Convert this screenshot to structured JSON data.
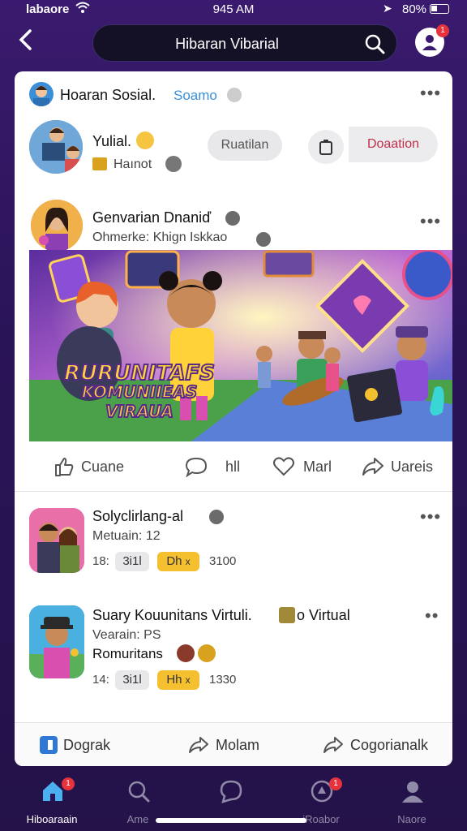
{
  "status_bar": {
    "carrier": "labaore",
    "time": "945 AM",
    "battery": "80%"
  },
  "header": {
    "title": "Hibaran Vibarial",
    "notification_count": "1"
  },
  "community": {
    "name": "Hoaran Sosial.",
    "tag": "Soamo"
  },
  "user": {
    "name": "Yulial.",
    "sub": "Haınot",
    "join_label": "Ruatilan",
    "donate_label": "Doaation"
  },
  "post": {
    "author": "Genvarian Dnaniď",
    "meta": "Ohmerke: Khign Iskkao",
    "banner_line1": "RURUNITAFS",
    "banner_line2": "KOMUNIIEAS",
    "banner_line3": "VIRAUA",
    "actions": {
      "like": "Cuane",
      "comment": "hll",
      "love": "Marl",
      "share": "Uareis"
    }
  },
  "list": [
    {
      "title": "Solyclirlang-al",
      "meta": "Metuain: 12",
      "stat_prefix": "18:",
      "pill1": "3i1l",
      "pill2": "Dh",
      "pill2_x": "x",
      "stat_suffix": "3100"
    },
    {
      "title": "Suary Kouunitans Virtuli.",
      "title_suffix": "o Virtual",
      "meta": "Vearain: PS",
      "meta2": "Romuritans",
      "stat_prefix": "14:",
      "pill1": "3i1l",
      "pill2": "Hh",
      "pill2_x": "x",
      "stat_suffix": "1330"
    }
  ],
  "card_footer": {
    "left": "Dograk",
    "center": "Molam",
    "right": "Cogorianalk"
  },
  "bottom_nav": {
    "items": [
      {
        "label": "Hiboaraain",
        "badge": "1"
      },
      {
        "label": "Ame"
      },
      {
        "label": ""
      },
      {
        "label": "iRoabor",
        "badge": "1"
      },
      {
        "label": "Naore"
      }
    ]
  },
  "colors": {
    "background": "#2a1458",
    "accent_blue": "#3a8fd8",
    "donate_red": "#c0304a",
    "badge_red": "#e5323c",
    "pill_gold": "#f4c030"
  }
}
